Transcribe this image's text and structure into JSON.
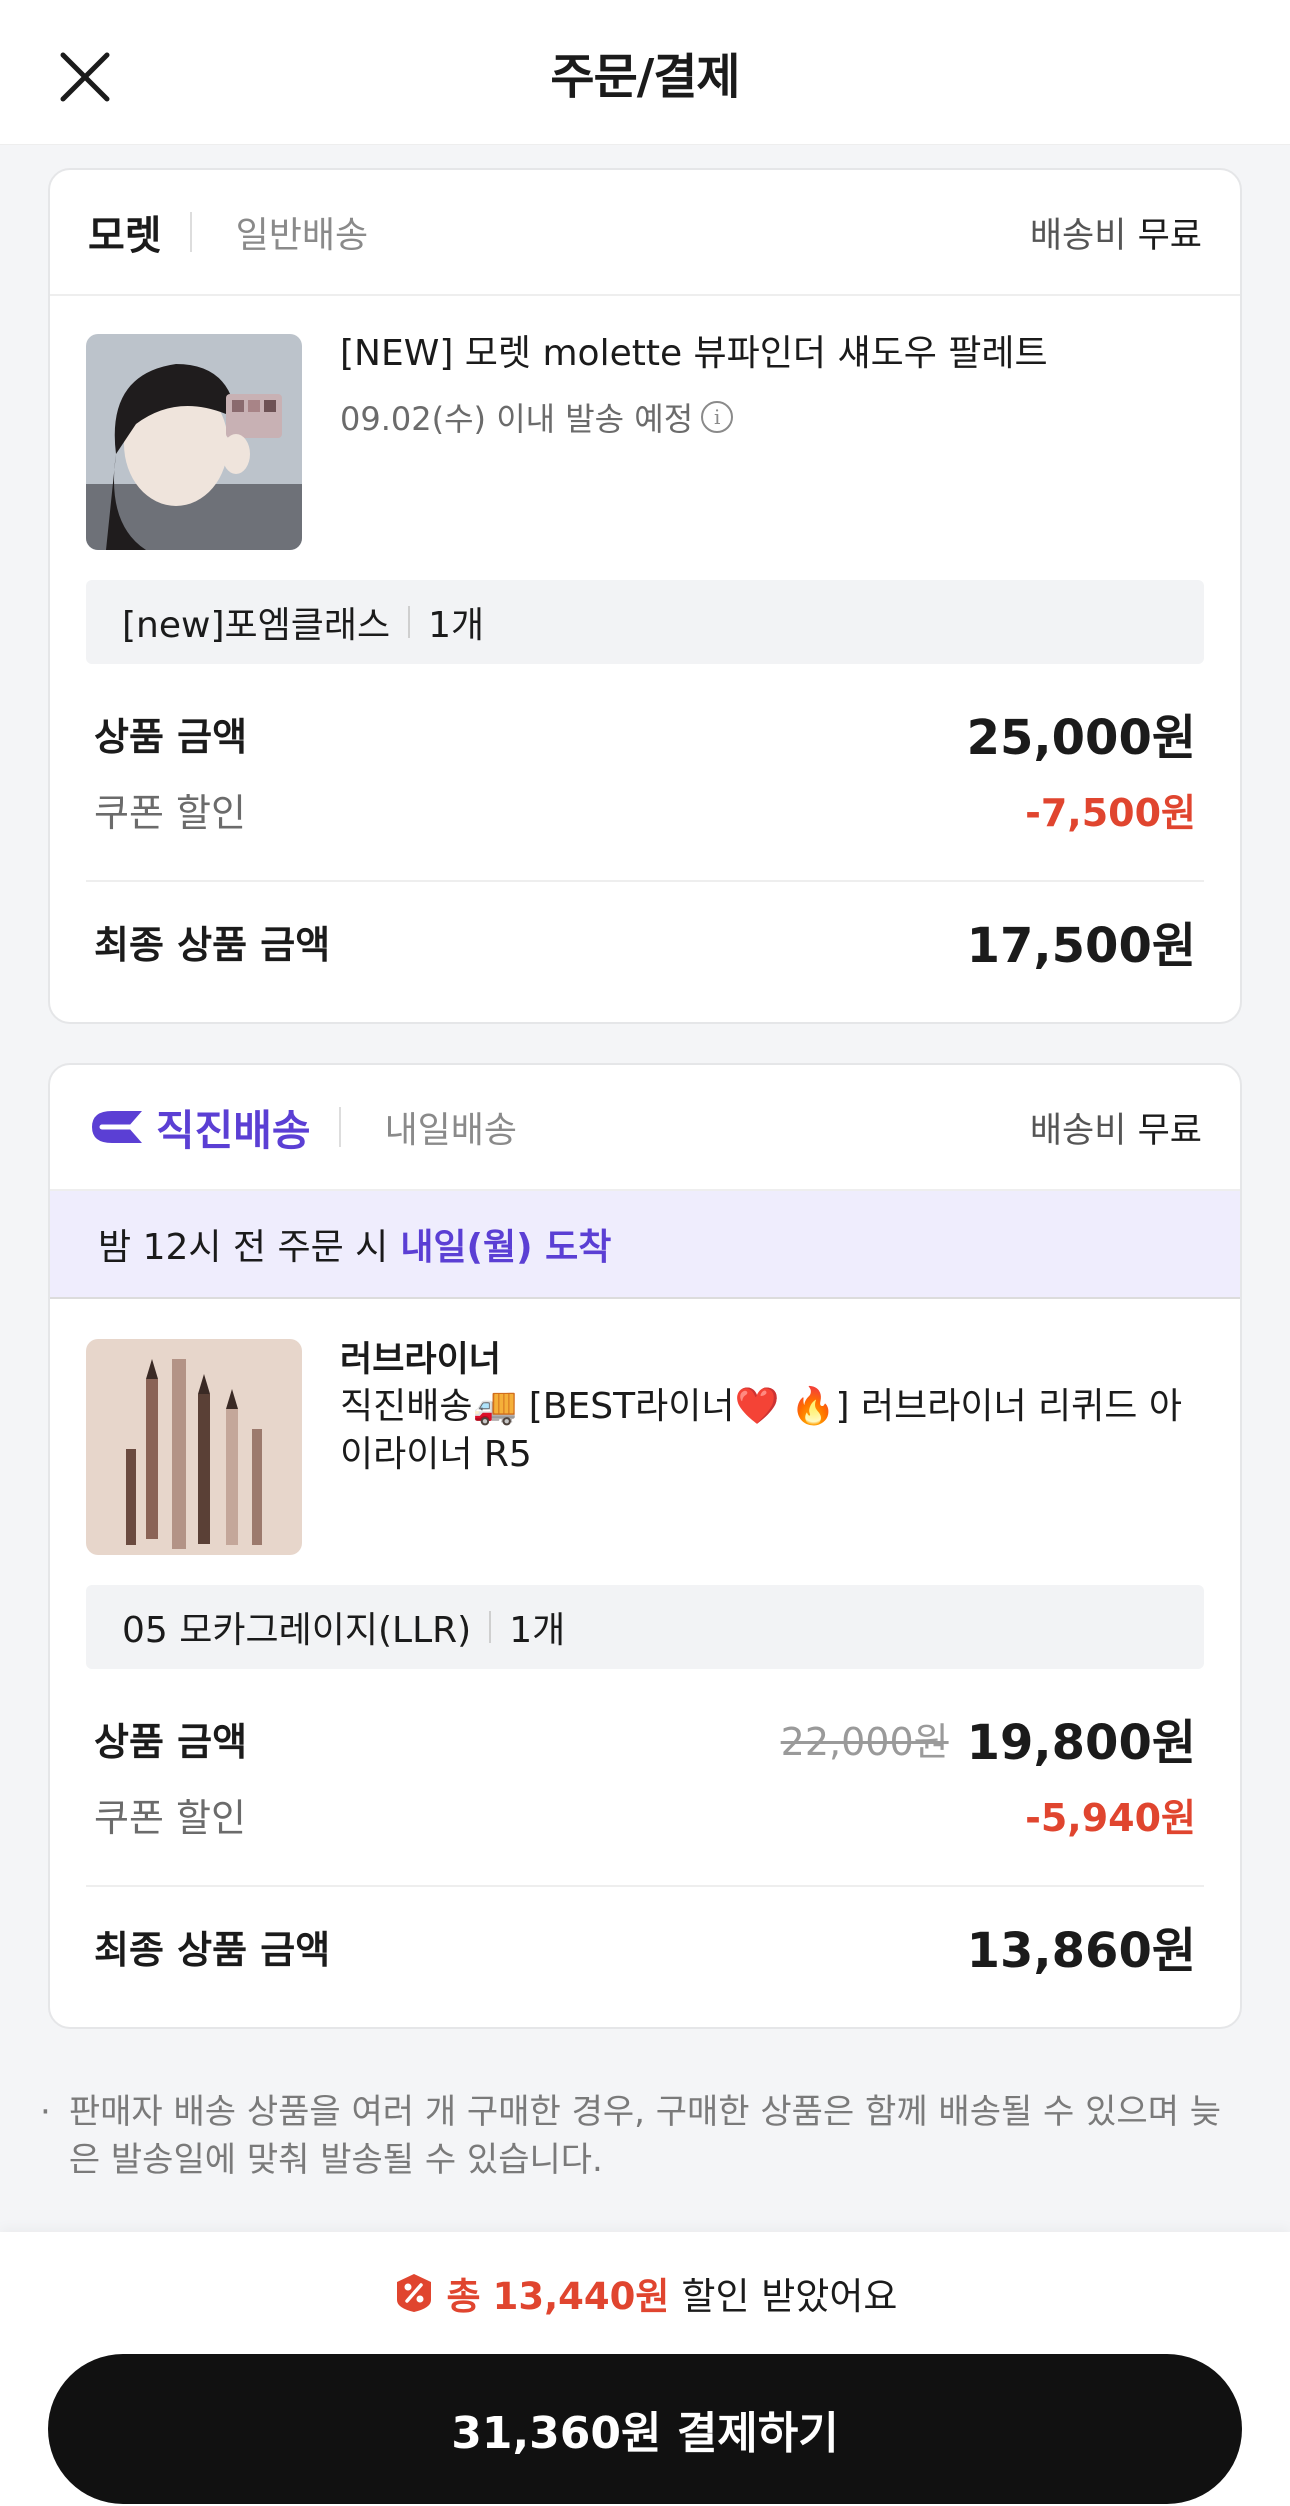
{
  "header": {
    "title": "주문/결제",
    "close_icon": "close-icon"
  },
  "order1": {
    "seller": "모렛",
    "ship_type": "일반배송",
    "ship_fee_label": "배송비",
    "ship_fee_value": "무료",
    "product_name": "[NEW] 모렛 molette 뷰파인더 섀도우 팔레트",
    "ship_date": "09.02(수) 이내 발송 예정",
    "option_name": "[new]포엠클래스",
    "option_qty": "1개",
    "price_label": "상품 금액",
    "price": "25,000원",
    "coupon_label": "쿠폰 할인",
    "coupon": "-7,500원",
    "final_label": "최종 상품 금액",
    "final": "17,500원"
  },
  "order2": {
    "brand_label": "직진배송",
    "ship_type": "내일배송",
    "ship_fee_label": "배송비",
    "ship_fee_value": "무료",
    "banner_prefix": "밤 12시 전 주문 시",
    "banner_highlight": "내일(월) 도착",
    "product_brand": "러브라이너",
    "product_name": "직진배송🚚 [BEST라이너❤️ 🔥] 러브라이너 리퀴드 아이라이너 R5",
    "option_name": "05 모카그레이지(LLR)",
    "option_qty": "1개",
    "price_label": "상품 금액",
    "original_price": "22,000원",
    "price": "19,800원",
    "coupon_label": "쿠폰 할인",
    "coupon": "-5,940원",
    "final_label": "최종 상품 금액",
    "final": "13,860원"
  },
  "note": "판매자 배송 상품을 여러 개 구매한 경우, 구매한 상품은 함께 배송될 수 있으며 늦은 발송일에 맞춰 발송될 수 있습니다.",
  "bottom": {
    "saving_prefix": "총",
    "saving_amount": "13,440원",
    "saving_suffix": "할인 받았어요",
    "pay_button": "31,360원 결제하기"
  },
  "colors": {
    "accent_purple": "#5b3fd4",
    "discount_red": "#e0452f",
    "button_black": "#111111"
  }
}
